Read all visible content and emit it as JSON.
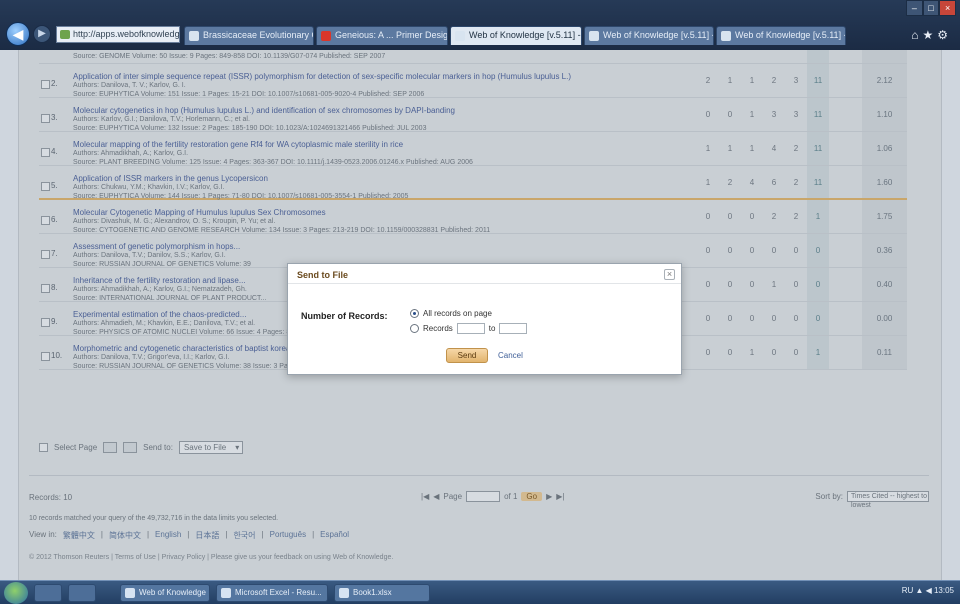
{
  "browser": {
    "address_text": "http://apps.webofknowledge.com/...",
    "tabs": [
      {
        "label": "Brassicaceae Evolutionary Gen...",
        "state": "normal"
      },
      {
        "label": "Geneious: A ... Primer Design...",
        "state": "red"
      },
      {
        "label": "Web of Knowledge [v.5.11] - ...",
        "state": "active"
      },
      {
        "label": "Web of Knowledge [v.5.11] - Res...",
        "state": "normal"
      },
      {
        "label": "Web of Knowledge [v.5.11] - Res...",
        "state": "normal"
      }
    ]
  },
  "results": [
    {
      "num": "",
      "title": "",
      "authors": "",
      "source": "Source: GENOME  Volume: 50  Issue: 9  Pages: 849-858  DOI: 10.1139/G07-074  Published: SEP 2007",
      "cites": [
        "",
        "",
        "",
        "",
        "",
        ""
      ],
      "total": ""
    },
    {
      "num": "2.",
      "title": "Application of inter simple sequence repeat (ISSR) polymorphism for detection of sex-specific molecular markers in hop (Humulus lupulus L.)",
      "authors": "Authors: Danilova, T. V.; Karlov, G. I.",
      "source": "Source: EUPHYTICA  Volume: 151  Issue: 1  Pages: 15-21  DOI: 10.1007/s10681-005-9020-4  Published: SEP 2006",
      "cites": [
        "2",
        "1",
        "1",
        "2",
        "3",
        "11"
      ],
      "total": "2.12"
    },
    {
      "num": "3.",
      "title": "Molecular cytogenetics in hop (Humulus lupulus L.) and identification of sex chromosomes by DAPI-banding",
      "authors": "Authors: Karlov, G.I.; Danilova, T.V.; Horlemann, C.; et al.",
      "source": "Source: EUPHYTICA  Volume: 132  Issue: 2  Pages: 185-190  DOI: 10.1023/A:1024691321466  Published: JUL 2003",
      "cites": [
        "0",
        "0",
        "1",
        "3",
        "3",
        "11"
      ],
      "total": "1.10"
    },
    {
      "num": "4.",
      "title": "Molecular mapping of the fertility restoration gene Rf4 for WA cytoplasmic male sterility in rice",
      "authors": "Authors: Ahmadikhah, A.; Karlov, G.I.",
      "source": "Source: PLANT BREEDING  Volume: 125  Issue: 4  Pages: 363-367  DOI: 10.1111/j.1439-0523.2006.01246.x  Published: AUG 2006",
      "cites": [
        "1",
        "1",
        "1",
        "4",
        "2",
        "11"
      ],
      "total": "1.06"
    },
    {
      "num": "5.",
      "title": "Application of ISSR markers in the genus Lycopersicon",
      "authors": "Authors: Chukwu, Y.M.; Khavkin, I.V.; Karlov, G.I.",
      "source": "Source: EUPHYTICA  Volume: 144  Issue: 1  Pages: 71-80  DOI: 10.1007/s10681-005-3554-1  Published: 2005",
      "cites": [
        "1",
        "2",
        "4",
        "6",
        "2",
        "11"
      ],
      "total": "1.60"
    },
    {
      "num": "6.",
      "title": "Molecular Cytogenetic Mapping of Humulus lupulus Sex Chromosomes",
      "authors": "Authors: Divashuk, M. G.; Alexandrov, O. S.; Kroupin, P. Yu; et al.",
      "source": "Source: CYTOGENETIC AND GENOME RESEARCH  Volume: 134  Issue: 3  Pages: 213-219  DOI: 10.1159/000328831  Published: 2011",
      "cites": [
        "0",
        "0",
        "0",
        "2",
        "2",
        "1"
      ],
      "total": "1.75"
    },
    {
      "num": "7.",
      "title": "Assessment of genetic polymorphism in hops...",
      "authors": "Authors: Danilova, T.V.; Danilov, S.S.; Karlov, G.I.",
      "source": "Source: RUSSIAN JOURNAL OF GENETICS  Volume: 39",
      "cites": [
        "0",
        "0",
        "0",
        "0",
        "0",
        "0"
      ],
      "total": "0.36"
    },
    {
      "num": "8.",
      "title": "Inheritance of the fertility restoration and lipase...",
      "authors": "Authors: Ahmadikhah, A.; Karlov, G.I.; Nematzadeh, Gh.",
      "source": "Source: INTERNATIONAL JOURNAL OF PLANT PRODUCT...",
      "cites": [
        "0",
        "0",
        "0",
        "1",
        "0",
        "0"
      ],
      "total": "0.40"
    },
    {
      "num": "9.",
      "title": "Experimental estimation of the chaos-predicted...",
      "authors": "Authors: Ahmadieh, M.; Khavkin, E.E.; Danilova, T.V.; et al.",
      "source": "Source: PHYSICS OF ATOMIC NUCLEI  Volume: 66  Issue: 4  Pages: 805-808  DOI: 10.1134/1.1570621  Published: MAY 2003",
      "cites": [
        "0",
        "0",
        "0",
        "0",
        "0",
        "0"
      ],
      "total": "0.00"
    },
    {
      "num": "10.",
      "title": "Morphometric and cytogenetic characteristics of baptist korean plants",
      "authors": "Authors: Danilova, T.V.; Grigor'eva, I.I.; Karlov, G.I.",
      "source": "Source: RUSSIAN JOURNAL OF GENETICS  Volume: 38  Issue: 3  Pages: 45-56  Published: JAN 2002",
      "cites": [
        "0",
        "0",
        "1",
        "0",
        "0",
        "1"
      ],
      "total": "0.11"
    }
  ],
  "bottom_toolbar": {
    "select_page": "Select Page",
    "send_to": "Send to:",
    "send_to_value": "Save to File"
  },
  "footer": {
    "records_label": "Records: 10",
    "page_label": "Page",
    "page_of": "of 1",
    "go_label": "Go",
    "sort_label": "Sort by:",
    "sort_value": "Times Cited -- highest to lowest",
    "matched_text": "10 records matched your query of the 49,732,716 in the data limits you selected.",
    "lang_label": "View in:",
    "languages": [
      "繁體中文",
      "简体中文",
      "English",
      "日本語",
      "한국어",
      "Português",
      "Español"
    ],
    "copyright": "© 2012 Thomson Reuters  |  Terms of Use  |  Privacy Policy  |  Please give us your feedback on using Web of Knowledge."
  },
  "modal": {
    "title": "Send to File",
    "close_glyph": "×",
    "number_of_records_label": "Number of Records:",
    "option_all": "All records on page",
    "option_range": "Records",
    "range_to": "to",
    "send_label": "Send",
    "cancel_label": "Cancel"
  },
  "taskbar": {
    "tasks": [
      "Web of Knowledge",
      "Microsoft Excel - Resu...",
      "Book1.xlsx"
    ],
    "tray": "RU  ▲ ◀ 13:05"
  }
}
